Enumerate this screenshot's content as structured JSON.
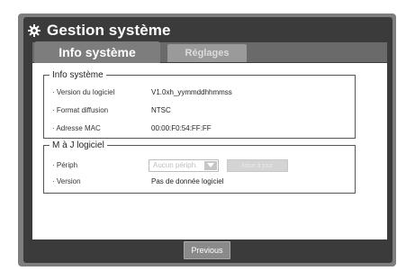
{
  "window": {
    "title": "Gestion système"
  },
  "tabs": [
    {
      "label": "Info système",
      "active": true
    },
    {
      "label": "Réglages",
      "active": false
    }
  ],
  "info_systeme": {
    "legend": "Info système",
    "rows": [
      {
        "label": "· Version du logiciel",
        "value": "V1.0xh_yymmddhhmmss"
      },
      {
        "label": "· Format diffusion",
        "value": "NTSC"
      },
      {
        "label": "· Adresse MAC",
        "value": "00:00:F0:54:FF:FF"
      }
    ]
  },
  "maj_logiciel": {
    "legend": "M à J logiciel",
    "periph_label": "· Périph",
    "periph_value": "Aucun périph.",
    "update_button": "Mise à jour",
    "version_label": "· Version",
    "version_value": "Pas de donnée logiciel"
  },
  "footer": {
    "previous_label": "Previous"
  },
  "colors": {
    "frame": "#7e7e7e",
    "dark_bg": "#3b3b3b",
    "tab_active": "#7d7d7d",
    "tab_inactive": "#9a9a9a",
    "panel": "#ffffff"
  },
  "icons": {
    "title_icon": "gear-icon",
    "dropdown_icon": "chevron-down-icon"
  }
}
